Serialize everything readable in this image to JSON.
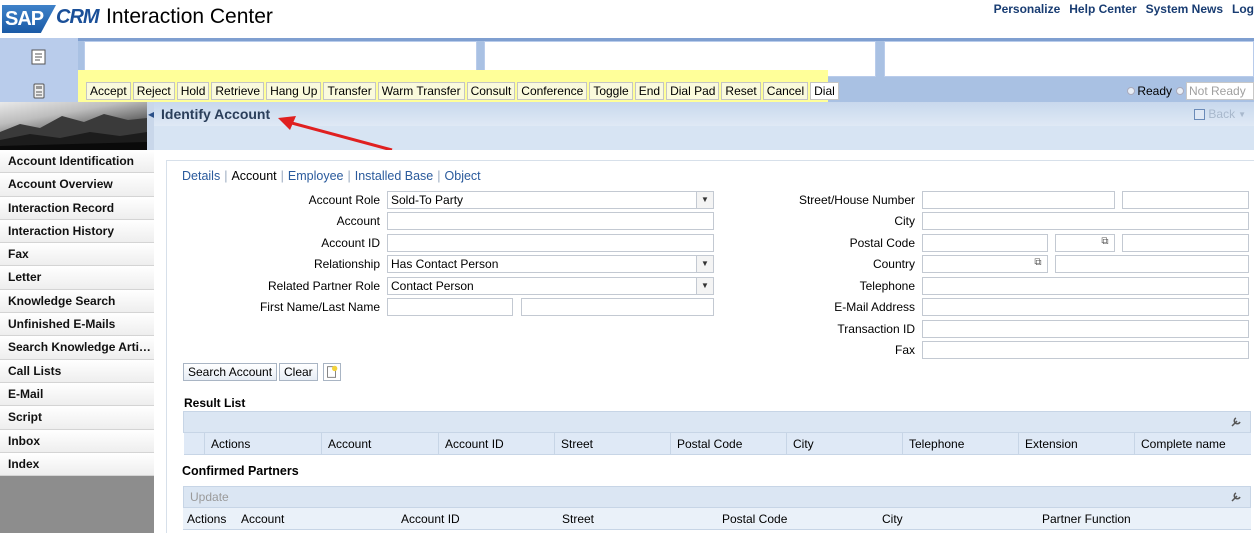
{
  "header": {
    "logo_sap": "SAP",
    "logo_crm": "CRM",
    "title": "Interaction Center",
    "links": [
      "Personalize",
      "Help Center",
      "System News",
      "Log"
    ]
  },
  "toolbar": {
    "buttons": [
      "Accept",
      "Reject",
      "Hold",
      "Retrieve",
      "Hang Up",
      "Transfer",
      "Warm Transfer",
      "Consult",
      "Conference",
      "Toggle",
      "End",
      "Dial Pad",
      "Reset",
      "Cancel"
    ],
    "dial_label": "Dial",
    "ready_label": "Ready",
    "not_ready_label": "Not Ready"
  },
  "nav": {
    "items": [
      "Account Identification",
      "Account Overview",
      "Interaction Record",
      "Interaction History",
      "Fax",
      "Letter",
      "Knowledge Search",
      "Unfinished E-Mails",
      "Search Knowledge Arti…",
      "Call Lists",
      "E-Mail",
      "Script",
      "Inbox",
      "Index"
    ]
  },
  "page": {
    "title": "Identify Account",
    "back_label": "Back"
  },
  "tabs": [
    "Details",
    "Account",
    "Employee",
    "Installed Base",
    "Object"
  ],
  "active_tab": "Account",
  "form_left": {
    "account_role_label": "Account Role",
    "account_role_value": "Sold-To Party",
    "account_label": "Account",
    "account_id_label": "Account ID",
    "relationship_label": "Relationship",
    "relationship_value": "Has Contact Person",
    "related_partner_role_label": "Related Partner Role",
    "related_partner_role_value": "Contact Person",
    "name_label": "First Name/Last Name"
  },
  "form_right": {
    "street_label": "Street/House Number",
    "city_label": "City",
    "postal_code_label": "Postal Code",
    "country_label": "Country",
    "telephone_label": "Telephone",
    "email_label": "E-Mail Address",
    "transaction_id_label": "Transaction ID",
    "fax_label": "Fax"
  },
  "actions": {
    "search_label": "Search Account",
    "clear_label": "Clear"
  },
  "result_list": {
    "title": "Result List",
    "columns": [
      "Actions",
      "Account",
      "Account ID",
      "Street",
      "Postal Code",
      "City",
      "Telephone",
      "Extension",
      "Complete name"
    ]
  },
  "confirmed_partners": {
    "title": "Confirmed Partners",
    "update_label": "Update",
    "columns": [
      "Actions",
      "Account",
      "Account ID",
      "Street",
      "Postal Code",
      "City",
      "Partner Function"
    ]
  },
  "colors": {
    "band": "#a9c1e3",
    "cti_highlight": "#ffff99",
    "link": "#2a5a9c",
    "annotation_arrow": "#e02020"
  }
}
